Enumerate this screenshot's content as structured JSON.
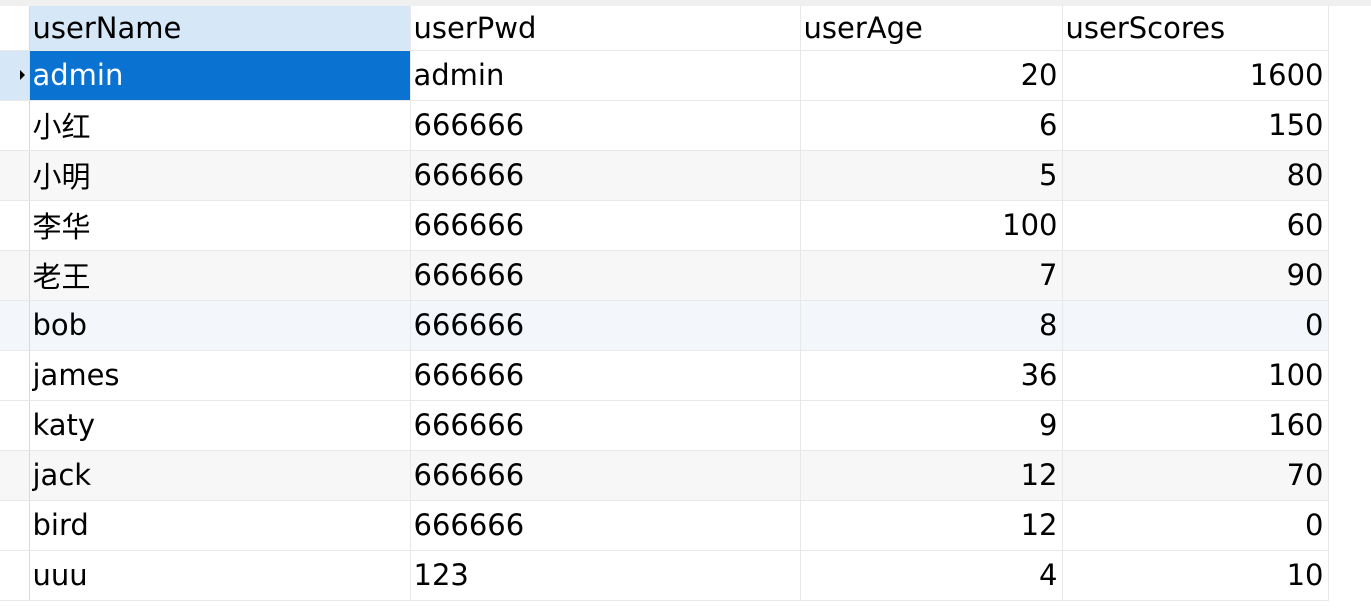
{
  "columns": [
    "userName",
    "userPwd",
    "userAge",
    "userScores"
  ],
  "rows": [
    {
      "userName": "admin",
      "userPwd": "admin",
      "userAge": "20",
      "userScores": "1600"
    },
    {
      "userName": "小红",
      "userPwd": "666666",
      "userAge": "6",
      "userScores": "150"
    },
    {
      "userName": "小明",
      "userPwd": "666666",
      "userAge": "5",
      "userScores": "80"
    },
    {
      "userName": "李华",
      "userPwd": "666666",
      "userAge": "100",
      "userScores": "60"
    },
    {
      "userName": "老王",
      "userPwd": "666666",
      "userAge": "7",
      "userScores": "90"
    },
    {
      "userName": "bob",
      "userPwd": "666666",
      "userAge": "8",
      "userScores": "0"
    },
    {
      "userName": "james",
      "userPwd": "666666",
      "userAge": "36",
      "userScores": "100"
    },
    {
      "userName": "katy",
      "userPwd": "666666",
      "userAge": "9",
      "userScores": "160"
    },
    {
      "userName": "jack",
      "userPwd": "666666",
      "userAge": "12",
      "userScores": "70"
    },
    {
      "userName": "bird",
      "userPwd": "666666",
      "userAge": "12",
      "userScores": "0"
    },
    {
      "userName": "uuu",
      "userPwd": "123",
      "userAge": "4",
      "userScores": "10"
    }
  ],
  "selection": {
    "row": 0,
    "column": "userName"
  },
  "colors": {
    "selected_cell": "#0a72d1",
    "selected_header": "#d6e8f7",
    "alt_row": "#f7f7f7",
    "hover_row": "#f3f7fc"
  }
}
